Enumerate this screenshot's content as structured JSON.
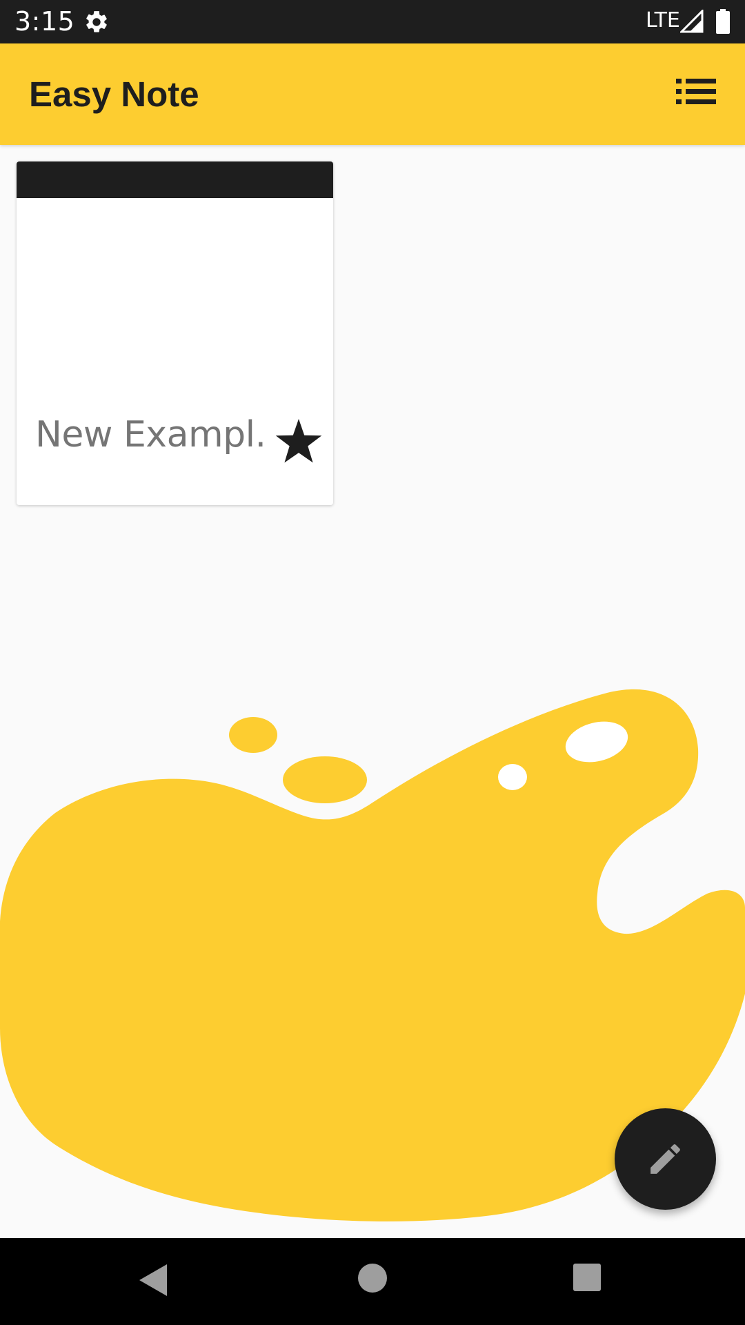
{
  "status_bar": {
    "time": "3:15",
    "network": "LTE",
    "icons": [
      "gear-icon",
      "cell-signal-icon",
      "battery-icon"
    ]
  },
  "app_bar": {
    "title": "Easy Note",
    "action_icon": "list-view-icon"
  },
  "notes": [
    {
      "title": "New Exampl...",
      "starred": true,
      "header_color": "#1e1e1e"
    }
  ],
  "fab": {
    "icon": "pencil-icon"
  },
  "nav_bar": {
    "icons": [
      "back-icon",
      "home-icon",
      "recents-icon"
    ]
  },
  "colors": {
    "accent": "#fdcd30",
    "dark": "#1e1e1e",
    "background": "#fafafa"
  }
}
